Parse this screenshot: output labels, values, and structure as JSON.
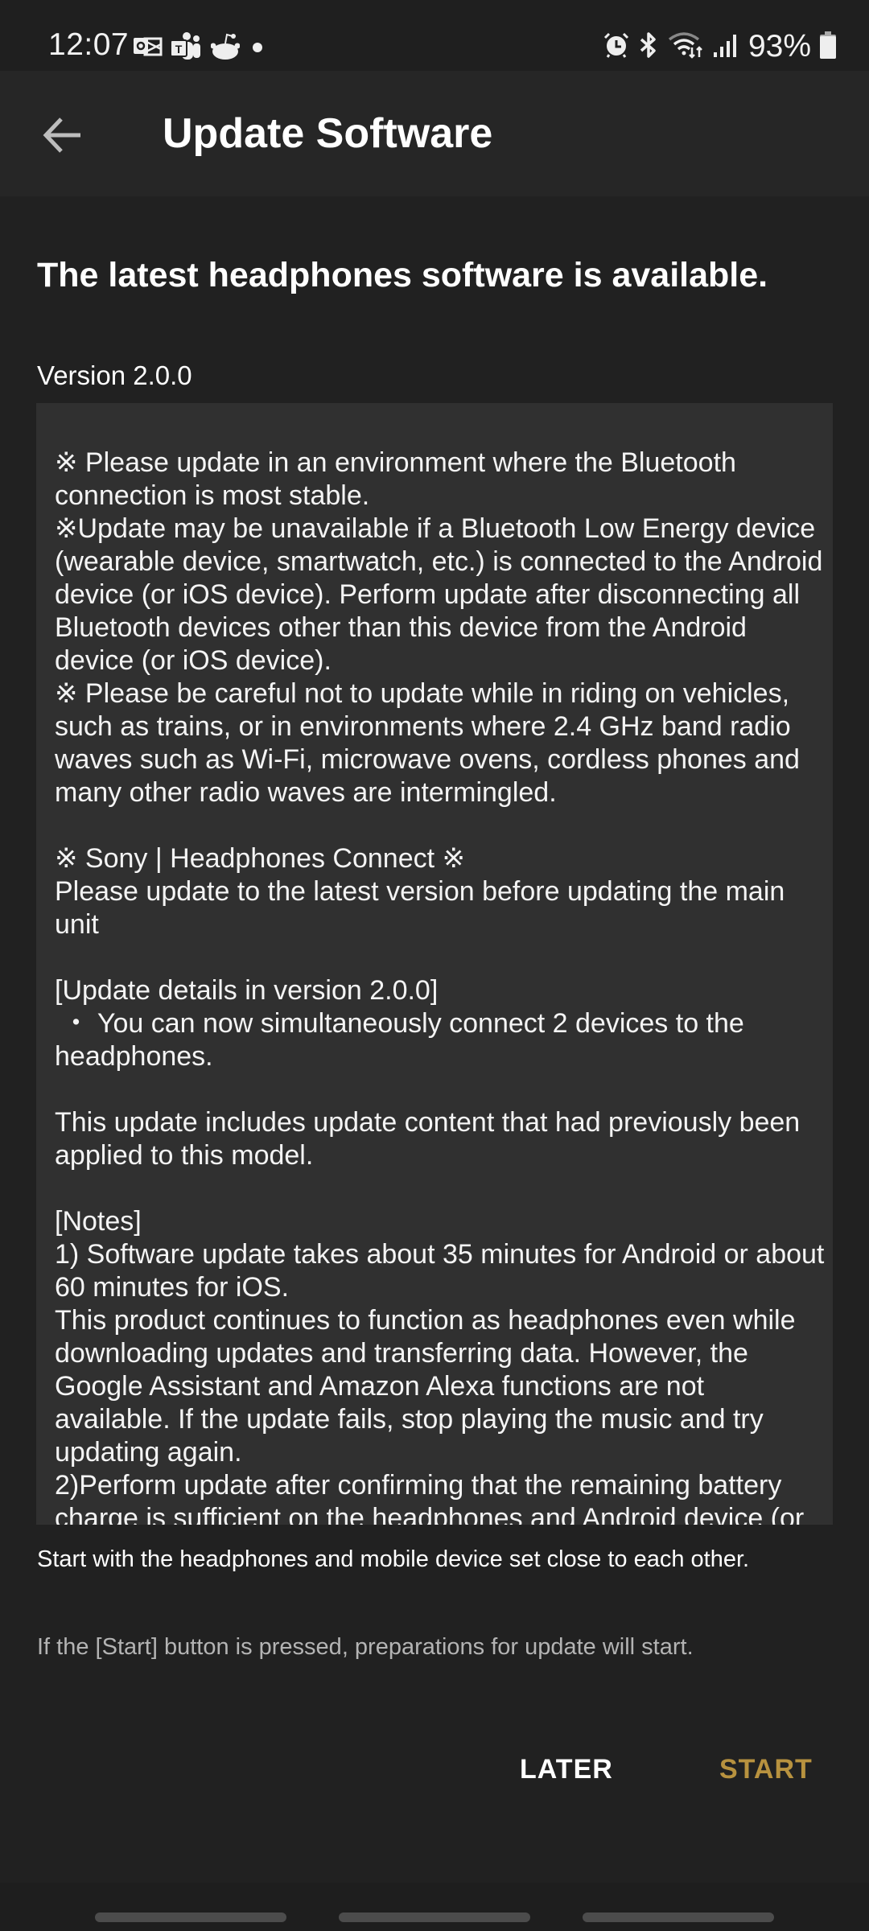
{
  "status_bar": {
    "time": "12:07",
    "notification_icons": [
      "outlook-icon",
      "teams-icon",
      "reddit-icon",
      "more-notifications-dot"
    ],
    "system_icons": [
      "alarm-icon",
      "bluetooth-icon",
      "wifi-icon",
      "cellular-signal-icon",
      "battery-icon"
    ],
    "battery_percent": "93%"
  },
  "app_bar": {
    "back_icon": "arrow-left-icon",
    "title": "Update Software"
  },
  "content": {
    "headline": "The latest headphones software is available.",
    "version_label": "Version 2.0.0",
    "release_notes": "※ Please update in an environment where the Bluetooth connection is most stable.\n※Update may be unavailable if a Bluetooth Low Energy device (wearable device, smartwatch, etc.) is connected to the Android device (or iOS device). Perform update after disconnecting all Bluetooth devices other than this device from the Android device (or iOS device).\n※ Please be careful not to update while in riding on vehicles, such as trains, or in environments where 2.4 GHz band radio waves such as Wi-Fi, microwave ovens, cordless phones and many other radio waves are intermingled.\n\n※ Sony | Headphones Connect ※\nPlease update to the latest version before updating the main unit\n\n[Update details in version 2.0.0]\n ・ You can now simultaneously connect 2 devices to the headphones.\n\nThis update includes update content that had previously been applied to this model.\n\n[Notes]\n1) Software update takes about 35 minutes for Android or about 60 minutes for iOS.\nThis product continues to function as headphones even while downloading updates and transferring data. However, the Google Assistant and Amazon Alexa functions are not available. If the update fails, stop playing the music and try updating again.\n2)Perform update after confirming that the remaining battery charge is sufficient on the headphones and Android device (or",
    "hint_primary": "Start with the headphones and mobile device set close to each other.",
    "hint_secondary": "If the [Start] button is pressed, preparations for update will start."
  },
  "actions": {
    "later_label": "LATER",
    "start_label": "START"
  },
  "colors": {
    "background": "#212121",
    "notes_background": "#303030",
    "accent": "#b8923f"
  }
}
